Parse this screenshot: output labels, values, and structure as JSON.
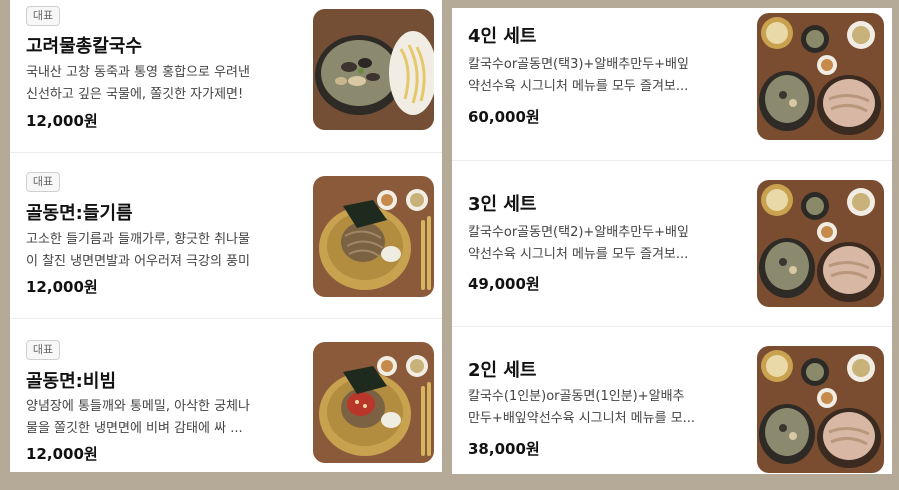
{
  "left": {
    "items": [
      {
        "badge": "대표",
        "name": "고려물총칼국수",
        "desc_lines": [
          "국내산 고창 동죽과 통영 홍합으로 우려낸",
          "신선하고 깊은 국물에, 쫄깃한 자가제면!"
        ],
        "price": "12,000원",
        "image": "clam-kalguksu-photo"
      },
      {
        "badge": "대표",
        "name": "골동면:들기름",
        "desc_lines": [
          "고소한 들기름과 들깨가루, 향긋한 취나물",
          "이 찰진 냉면면발과 어우러져 극강의 풍미"
        ],
        "price": "12,000원",
        "image": "perilla-noodles-photo"
      },
      {
        "badge": "대표",
        "name": "골동면:비빔",
        "desc_lines": [
          "양념장에 통들깨와 통메밀, 아삭한 궁체나",
          "물을 쫄깃한 냉면면에 비벼 감태에 싸 ..."
        ],
        "price": "12,000원",
        "image": "spicy-noodles-photo"
      }
    ]
  },
  "right": {
    "items": [
      {
        "name": "4인 세트",
        "desc_lines": [
          "칼국수or골동면(택3)+알배추만두+배잎",
          "약선수육 시그니처 메뉴를 모두 즐겨보..."
        ],
        "price": "60,000원",
        "image": "set-meal-photo"
      },
      {
        "name": "3인 세트",
        "desc_lines": [
          "칼국수or골동면(택2)+알배추만두+배잎",
          "약선수육 시그니처 메뉴를 모두 즐겨보..."
        ],
        "price": "49,000원",
        "image": "set-meal-photo"
      },
      {
        "name": "2인 세트",
        "desc_lines": [
          "칼국수(1인분)or골동면(1인분)+알배추",
          "만두+배잎약선수육 시그니처 메뉴를 모..."
        ],
        "price": "38,000원",
        "image": "set-meal-photo"
      }
    ]
  },
  "colors": {
    "background": "#b5a998",
    "panel": "#ffffff",
    "text": "#111111",
    "muted": "#444444",
    "badge_border": "#cfcfcf"
  }
}
